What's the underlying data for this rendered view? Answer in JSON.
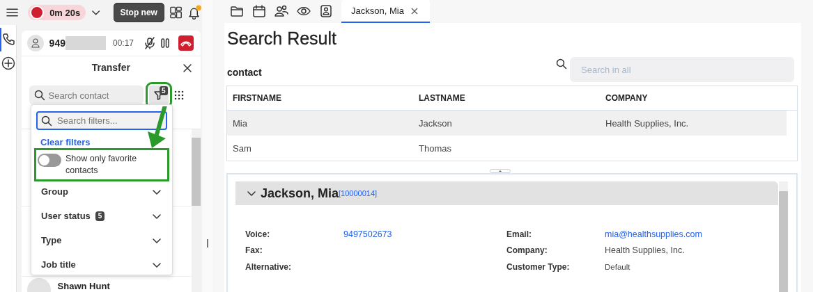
{
  "top_bar": {
    "recording": {
      "time": "0m 20s",
      "active": true
    },
    "stop_button": "Stop new",
    "notification": true
  },
  "rail": [
    {
      "kind": "phone",
      "selected": true
    },
    {
      "kind": "add",
      "selected": false
    }
  ],
  "call": {
    "number": "949",
    "redacted": true,
    "duration": "00:17"
  },
  "transfer": {
    "title": "Transfer",
    "search": {
      "placeholder": "Search contact"
    },
    "filter_count": "5",
    "filter_highlighted": true
  },
  "filters": {
    "search": {
      "placeholder": "Search filters..."
    },
    "clear": "Clear filters",
    "favorite_toggle": {
      "label": "Show only favorite contacts",
      "on": false,
      "highlighted": true
    },
    "groups": [
      {
        "label": "Group",
        "expanded": false
      },
      {
        "label": "User status",
        "count": "5",
        "expanded": false
      },
      {
        "label": "Type",
        "expanded": false
      },
      {
        "label": "Job title",
        "expanded": false
      }
    ]
  },
  "contacts": [
    {
      "name": "Shawn Hunt"
    }
  ],
  "toolbar": [
    {
      "kind": "folder"
    },
    {
      "kind": "calendar"
    },
    {
      "kind": "people"
    },
    {
      "kind": "eye"
    },
    {
      "kind": "contact"
    }
  ],
  "tabs": [
    {
      "label": "Jackson, Mia",
      "selected": true
    }
  ],
  "search_result": {
    "title": "Search Result",
    "section": "contact",
    "search": {
      "placeholder": "Search in all"
    },
    "columns": [
      "FIRSTNAME",
      "LASTNAME",
      "COMPANY"
    ],
    "rows": [
      {
        "cells": [
          "Mia",
          "Jackson",
          "Health Supplies, Inc."
        ],
        "selected": true
      },
      {
        "cells": [
          "Sam",
          "Thomas"
        ],
        "selected": false
      }
    ]
  },
  "detail": {
    "name": "Jackson, Mia",
    "id": "[10000014]",
    "expanded": true,
    "left_fields": [
      {
        "label": "Voice:",
        "value": "9497502673",
        "kind": "link"
      },
      {
        "label": "Fax:",
        "kind": "empty"
      },
      {
        "label": "Alternative:",
        "kind": "empty"
      }
    ],
    "right_fields": [
      {
        "label": "Email:",
        "value": "mia@healthsupplies.com",
        "kind": "link"
      },
      {
        "label": "Company:",
        "value": "Health Supplies, Inc.",
        "kind": "text"
      },
      {
        "label": "Customer Type:",
        "value": "Default",
        "kind": "small"
      }
    ]
  }
}
